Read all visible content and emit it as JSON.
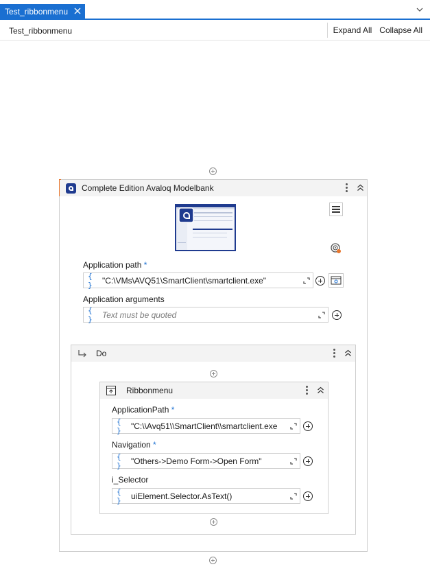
{
  "tab": {
    "label": "Test_ribbonmenu"
  },
  "breadcrumb": {
    "label": "Test_ribbonmenu"
  },
  "toolbar": {
    "expand_all": "Expand All",
    "collapse_all": "Collapse All"
  },
  "open_app": {
    "title": "Complete Edition Avaloq Modelbank",
    "application_path_label": "Application path",
    "application_path_value": "\"C:\\VMs\\AVQ51\\SmartClient\\smartclient.exe\"",
    "application_arguments_label": "Application arguments",
    "application_arguments_placeholder": "Text must be quoted",
    "required_mark": "*"
  },
  "do_sequence": {
    "title": "Do"
  },
  "ribbonmenu": {
    "title": "Ribbonmenu",
    "application_path_label": "ApplicationPath",
    "application_path_value": "\"C:\\\\Avq51\\\\SmartClient\\\\smartclient.exe",
    "navigation_label": "Navigation",
    "navigation_value": "\"Others->Demo Form->Open Form\"",
    "selector_label": "i_Selector",
    "selector_value": "uiElement.Selector.AsText()",
    "required_mark": "*"
  },
  "field_brace": "{ }",
  "colors": {
    "accent": "#1a6fd1",
    "header_bg": "#f3f3f3",
    "avaloq_brand": "#1f3b8f",
    "rail_orange": "#e8772e"
  }
}
